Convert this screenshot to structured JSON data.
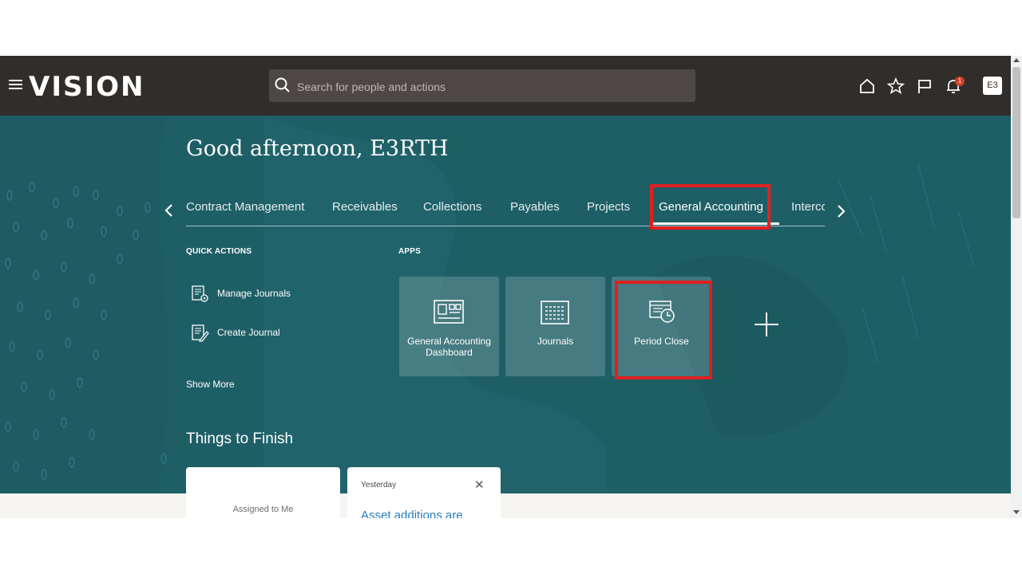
{
  "header": {
    "logo": "VISION",
    "search_placeholder": "Search for people and actions",
    "notification_count": "1",
    "avatar_initials": "E3"
  },
  "greeting": "Good afternoon, E3RTH",
  "tabs": [
    {
      "label": "Contract Management"
    },
    {
      "label": "Receivables"
    },
    {
      "label": "Collections"
    },
    {
      "label": "Payables"
    },
    {
      "label": "Projects"
    },
    {
      "label": "General Accounting",
      "active": true
    },
    {
      "label": "Interco"
    }
  ],
  "quick_actions": {
    "title": "QUICK ACTIONS",
    "items": [
      {
        "label": "Manage Journals"
      },
      {
        "label": "Create Journal"
      }
    ],
    "show_more": "Show More"
  },
  "apps": {
    "title": "APPS",
    "tiles": [
      {
        "label": "General Accounting Dashboard",
        "icon": "dashboard-icon"
      },
      {
        "label": "Journals",
        "icon": "journals-icon"
      },
      {
        "label": "Period Close",
        "icon": "period-close-icon"
      }
    ]
  },
  "things_to_finish": {
    "title": "Things to Finish",
    "card1_label": "Assigned to Me",
    "card2_date": "Yesterday",
    "card2_close": "✕",
    "card2_text": "Asset additions are"
  },
  "colors": {
    "header_bg": "#312d2a",
    "hero_bg": "#1e5f66",
    "highlight": "#e02020"
  }
}
